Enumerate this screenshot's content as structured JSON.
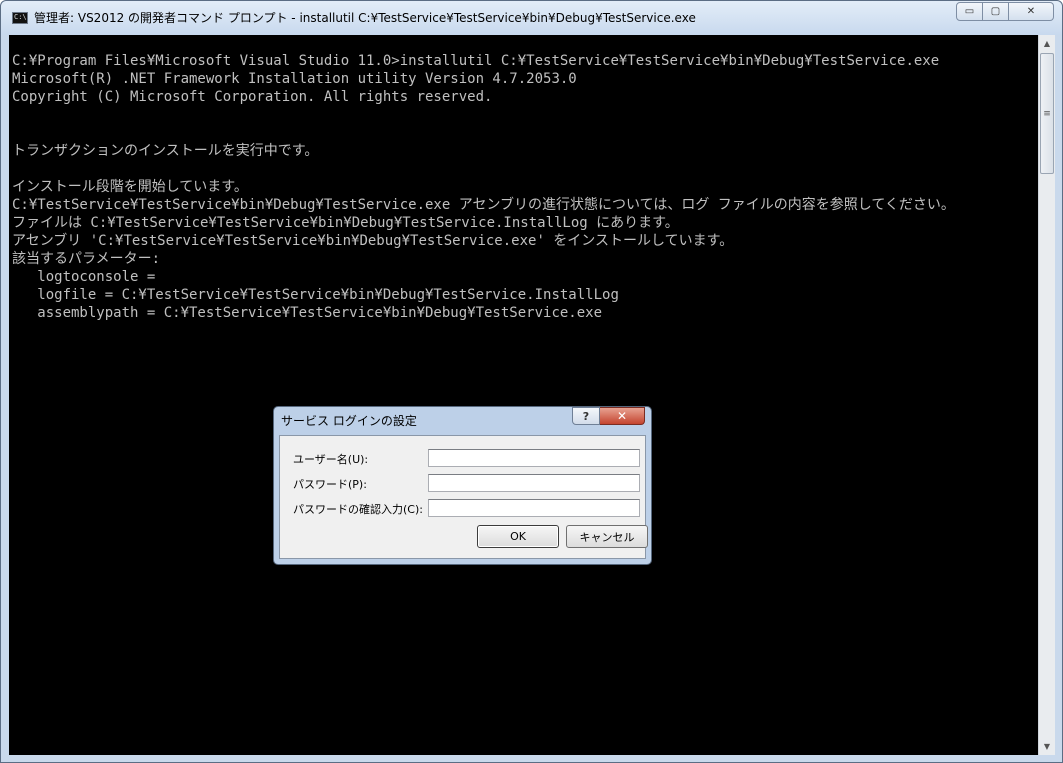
{
  "window": {
    "title": "管理者: VS2012 の開発者コマンド プロンプト - installutil  C:¥TestService¥TestService¥bin¥Debug¥TestService.exe",
    "icon": "console-icon",
    "min_glyph": "▭",
    "max_glyph": "▢",
    "close_glyph": "✕"
  },
  "console": {
    "lines": [
      "C:¥Program Files¥Microsoft Visual Studio 11.0>installutil C:¥TestService¥TestService¥bin¥Debug¥TestService.exe",
      "Microsoft(R) .NET Framework Installation utility Version 4.7.2053.0",
      "Copyright (C) Microsoft Corporation. All rights reserved.",
      "",
      "",
      "トランザクションのインストールを実行中です。",
      "",
      "インストール段階を開始しています。",
      "C:¥TestService¥TestService¥bin¥Debug¥TestService.exe アセンブリの進行状態については、ログ ファイルの内容を参照してください。",
      "ファイルは C:¥TestService¥TestService¥bin¥Debug¥TestService.InstallLog にあります。",
      "アセンブリ 'C:¥TestService¥TestService¥bin¥Debug¥TestService.exe' をインストールしています。",
      "該当するパラメーター:",
      "   logtoconsole =",
      "   logfile = C:¥TestService¥TestService¥bin¥Debug¥TestService.InstallLog",
      "   assemblypath = C:¥TestService¥TestService¥bin¥Debug¥TestService.exe"
    ],
    "text_color": "#c0c0c0",
    "background": "#000000"
  },
  "scrollbar": {
    "up_glyph": "▲",
    "down_glyph": "▼",
    "thumb_glyph": "≡"
  },
  "dialog": {
    "title": "サービス ログインの設定",
    "help_glyph": "?",
    "close_glyph": "✕",
    "fields": {
      "username": {
        "label": "ユーザー名(U):",
        "value": ""
      },
      "password": {
        "label": "パスワード(P):",
        "value": ""
      },
      "confirm": {
        "label": "パスワードの確認入力(C):",
        "value": ""
      }
    },
    "ok_label": "OK",
    "cancel_label": "キャンセル",
    "close_color": "#c4442f"
  }
}
